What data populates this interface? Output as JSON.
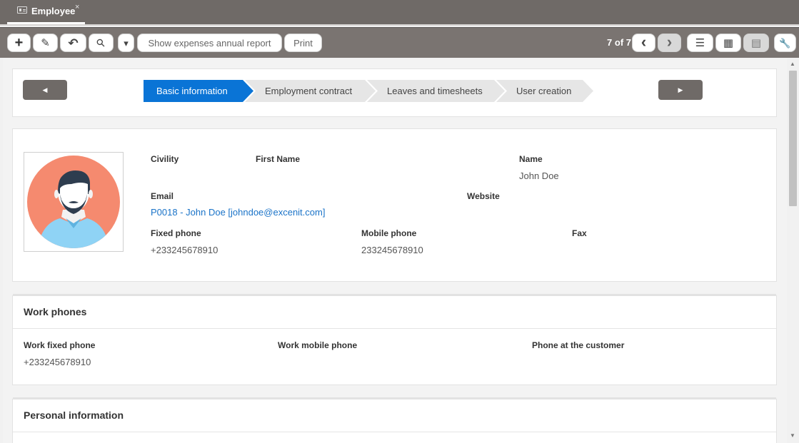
{
  "tab": {
    "title": "Employee",
    "close": "×"
  },
  "toolbar": {
    "new_icon": "+",
    "edit_icon": "✎",
    "undo_icon": "↶",
    "attach_icon": "⚲",
    "dropdown_icon": "▾",
    "expenses_report": "Show expenses annual report",
    "print": "Print",
    "counter": "7 of 7",
    "prev_icon": "‹",
    "next_icon": "›",
    "list_view_icon": "☰",
    "grid_view_icon": "▦",
    "form_view_icon": "▤",
    "settings_icon": "🔧"
  },
  "wizard": {
    "prev_icon": "◀",
    "next_icon": "▶",
    "steps": [
      "Basic information",
      "Employment contract",
      "Leaves and timesheets",
      "User creation"
    ],
    "active_step": 0
  },
  "profile": {
    "civility_label": "Civility",
    "first_name_label": "First Name",
    "name_label": "Name",
    "name_value": "John Doe",
    "email_label": "Email",
    "email_value": "P0018 - John Doe [johndoe@excenit.com]",
    "website_label": "Website",
    "fixed_phone_label": "Fixed phone",
    "fixed_phone_value": "+233245678910",
    "mobile_phone_label": "Mobile phone",
    "mobile_phone_value": "233245678910",
    "fax_label": "Fax"
  },
  "work_phones": {
    "title": "Work phones",
    "work_fixed_label": "Work fixed phone",
    "work_fixed_value": "+233245678910",
    "work_mobile_label": "Work mobile phone",
    "customer_phone_label": "Phone at the customer"
  },
  "personal_info": {
    "title": "Personal information"
  },
  "colors": {
    "primary": "#0a74d6",
    "header_bg": "#6f6a67",
    "avatar_bg": "#f58a6f",
    "shirt": "#8fd3f5",
    "hair": "#2e3d4f"
  }
}
